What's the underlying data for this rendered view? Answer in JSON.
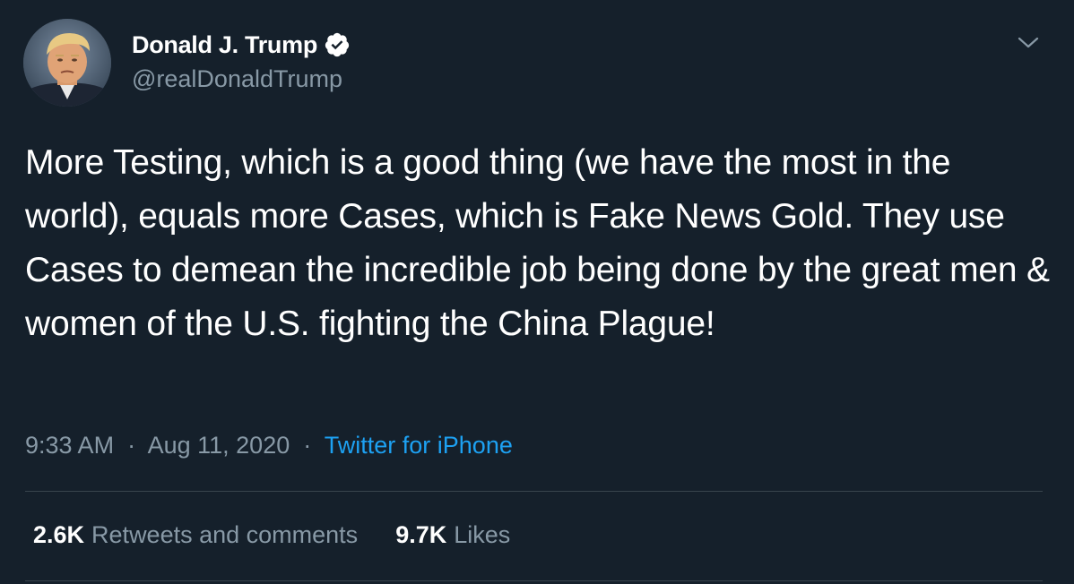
{
  "author": {
    "display_name": "Donald J. Trump",
    "handle": "@realDonaldTrump",
    "verified": true,
    "avatar_icon": "profile-photo"
  },
  "tweet": {
    "text": "More Testing, which is a good thing (we have the most in the world), equals more Cases, which is Fake News Gold. They use Cases to demean the incredible job being done by the great men & women of the U.S. fighting the China Plague!",
    "time": "9:33 AM",
    "separator": "·",
    "date": "Aug 11, 2020",
    "source": "Twitter for iPhone"
  },
  "stats": {
    "retweets_count": "2.6K",
    "retweets_label": "Retweets and comments",
    "likes_count": "9.7K",
    "likes_label": "Likes"
  },
  "icons": {
    "verified": "verified-badge-icon",
    "menu": "chevron-down-icon"
  },
  "colors": {
    "background": "#15202b",
    "text_primary": "#ffffff",
    "text_secondary": "#8899a6",
    "link": "#1da1f2",
    "divider": "#38444d"
  }
}
